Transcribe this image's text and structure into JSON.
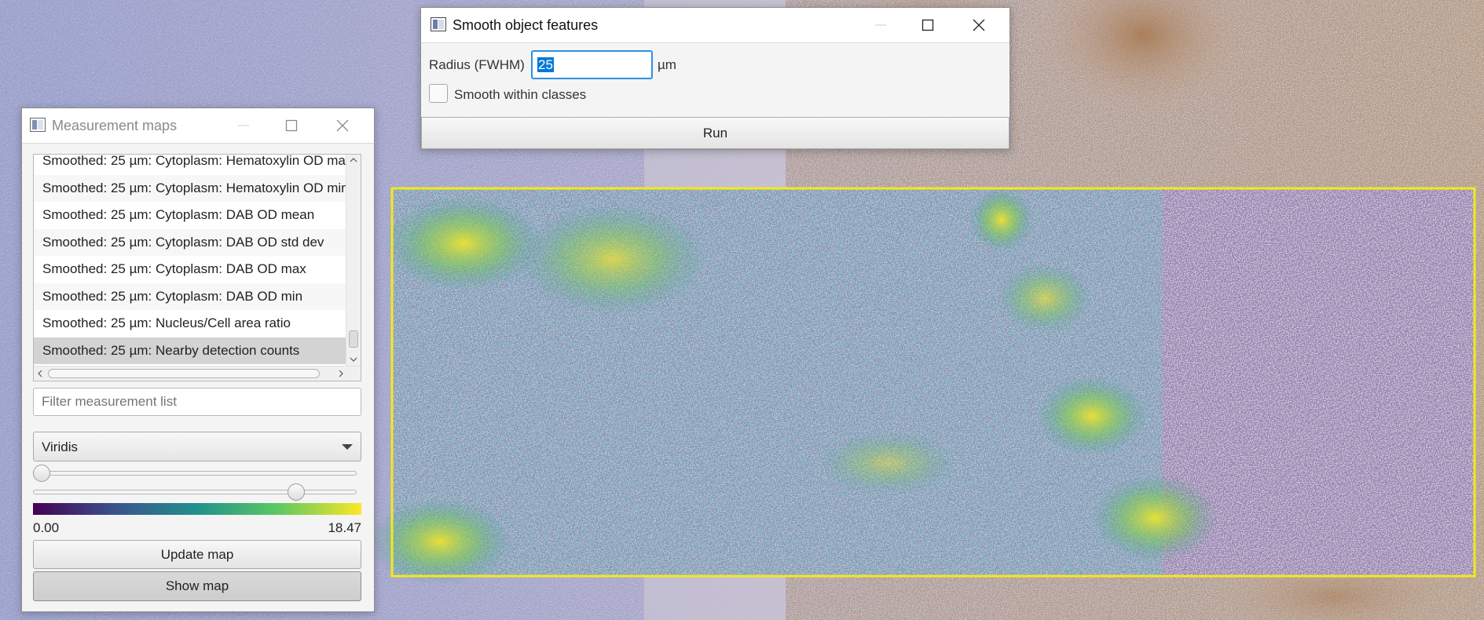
{
  "smooth_dialog": {
    "title": "Smooth object features",
    "radius_label": "Radius (FWHM)",
    "radius_value": "25",
    "radius_unit": "µm",
    "smooth_within_classes_label": "Smooth within classes",
    "smooth_within_classes_checked": false,
    "run_label": "Run"
  },
  "maps_dialog": {
    "title": "Measurement maps",
    "measurements": [
      "Smoothed: 25 µm: Cytoplasm: Hematoxylin OD max",
      "Smoothed: 25 µm: Cytoplasm: Hematoxylin OD min",
      "Smoothed: 25 µm: Cytoplasm: DAB OD mean",
      "Smoothed: 25 µm: Cytoplasm: DAB OD std dev",
      "Smoothed: 25 µm: Cytoplasm: DAB OD max",
      "Smoothed: 25 µm: Cytoplasm: DAB OD min",
      "Smoothed: 25 µm: Nucleus/Cell area ratio",
      "Smoothed: 25 µm: Nearby detection counts"
    ],
    "selected_measurement": "Smoothed: 25 µm: Nearby detection counts",
    "filter_placeholder": "Filter measurement list",
    "colormap": "Viridis",
    "min_slider_fraction": 0.0,
    "max_slider_fraction": 0.83,
    "min_value": "0.00",
    "max_value": "18.47",
    "update_map_label": "Update map",
    "show_map_label": "Show map"
  },
  "colors": {
    "selection_box": "#f2ea1b",
    "text_selection": "#0078d7",
    "focus_border": "#2f8fe0",
    "viridis": [
      "#440154",
      "#3b528b",
      "#21918c",
      "#5ec962",
      "#fde725"
    ]
  },
  "icons": [
    "app-icon",
    "minimize-icon",
    "maximize-icon",
    "close-icon",
    "chevron-up-icon",
    "chevron-down-icon",
    "chevron-left-icon",
    "chevron-right-icon",
    "dropdown-arrow-icon"
  ]
}
